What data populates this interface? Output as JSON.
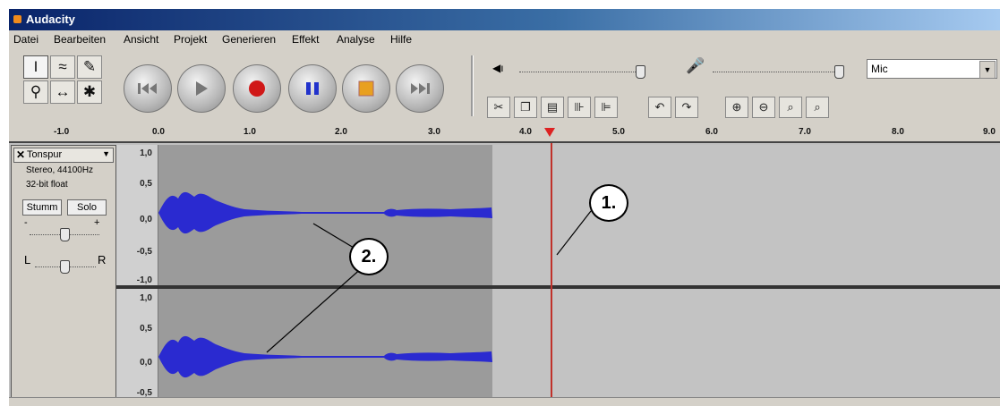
{
  "window": {
    "title": "Audacity"
  },
  "menu": [
    "Datei",
    "Bearbeiten",
    "Ansicht",
    "Projekt",
    "Generieren",
    "Effekt",
    "Analyse",
    "Hilfe"
  ],
  "input": {
    "device": "Mic"
  },
  "ruler": {
    "ticks": [
      "-1.0",
      "0.0",
      "1.0",
      "2.0",
      "3.0",
      "4.0",
      "5.0",
      "6.0",
      "7.0",
      "8.0",
      "9.0"
    ]
  },
  "track": {
    "name": "Tonspur",
    "info_line1": "Stereo, 44100Hz",
    "info_line2": "32-bit float",
    "mute_label": "Stumm",
    "solo_label": "Solo",
    "gain_minus": "-",
    "gain_plus": "+",
    "pan_left": "L",
    "pan_right": "R",
    "scale_top": [
      "1,0",
      "0,5",
      "0,0",
      "-0,5",
      "-1,0"
    ],
    "scale_bottom": [
      "1,0",
      "0,5",
      "0,0",
      "-0,5"
    ]
  },
  "annotations": {
    "cursor_label": "1.",
    "waveform_label": "2."
  },
  "colors": {
    "waveform": "#2a2ad0",
    "cursor": "#c0312a",
    "selection": "#9b9b9b",
    "record": "#d01818",
    "pause": "#2233cc",
    "stop": "#e8a020"
  }
}
